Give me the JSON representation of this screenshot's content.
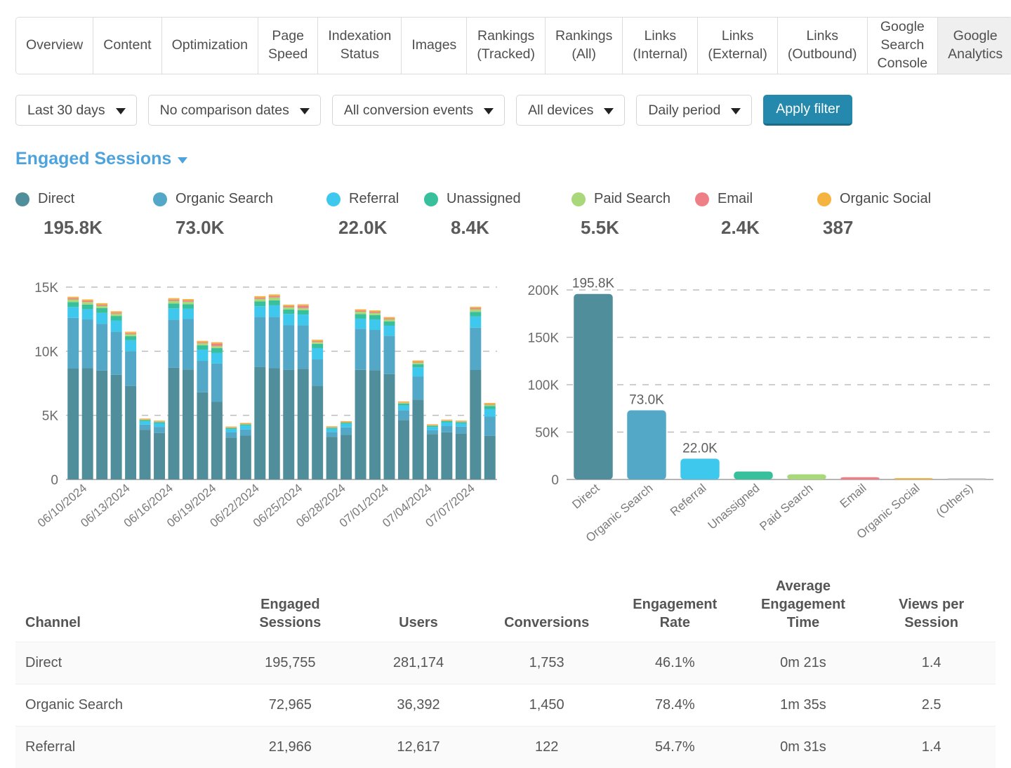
{
  "tabs": [
    {
      "label": "Overview",
      "active": false
    },
    {
      "label": "Content",
      "active": false
    },
    {
      "label": "Optimization",
      "active": false
    },
    {
      "label": "Page\nSpeed",
      "active": false
    },
    {
      "label": "Indexation\nStatus",
      "active": false
    },
    {
      "label": "Images",
      "active": false
    },
    {
      "label": "Rankings\n(Tracked)",
      "active": false
    },
    {
      "label": "Rankings\n(All)",
      "active": false
    },
    {
      "label": "Links\n(Internal)",
      "active": false
    },
    {
      "label": "Links\n(External)",
      "active": false
    },
    {
      "label": "Links\n(Outbound)",
      "active": false
    },
    {
      "label": "Google Search\nConsole",
      "active": false
    },
    {
      "label": "Google\nAnalytics",
      "active": true
    }
  ],
  "filters": {
    "date_range": "Last 30 days",
    "comparison": "No comparison dates",
    "conversion_events": "All conversion events",
    "devices": "All devices",
    "period": "Daily period",
    "apply_label": "Apply filter"
  },
  "metric": {
    "title": "Engaged Sessions"
  },
  "legend": [
    {
      "label": "Direct",
      "value": "195.8K",
      "color": "#4f8e9a"
    },
    {
      "label": "Organic Search",
      "value": "73.0K",
      "color": "#54a8c7"
    },
    {
      "label": "Referral",
      "value": "22.0K",
      "color": "#3ec8ee"
    },
    {
      "label": "Unassigned",
      "value": "8.4K",
      "color": "#38bf9c"
    },
    {
      "label": "Paid Search",
      "value": "5.5K",
      "color": "#a8d87a"
    },
    {
      "label": "Email",
      "value": "2.4K",
      "color": "#ef7f86"
    },
    {
      "label": "Organic Social",
      "value": "387",
      "color": "#f5b33f"
    }
  ],
  "chart_data": [
    {
      "type": "bar",
      "id": "daily-stacked",
      "stacked": true,
      "title": "",
      "xlabel": "",
      "ylabel": "",
      "ylim": [
        0,
        15000
      ],
      "yticks": [
        0,
        5000,
        10000,
        15000
      ],
      "ytick_labels": [
        "0",
        "5K",
        "10K",
        "15K"
      ],
      "grid": true,
      "legend_position": "top",
      "x": [
        "06/09/2024",
        "06/10/2024",
        "06/11/2024",
        "06/12/2024",
        "06/13/2024",
        "06/14/2024",
        "06/15/2024",
        "06/16/2024",
        "06/17/2024",
        "06/18/2024",
        "06/19/2024",
        "06/20/2024",
        "06/21/2024",
        "06/22/2024",
        "06/23/2024",
        "06/24/2024",
        "06/25/2024",
        "06/26/2024",
        "06/27/2024",
        "06/28/2024",
        "06/29/2024",
        "06/30/2024",
        "07/01/2024",
        "07/02/2024",
        "07/03/2024",
        "07/04/2024",
        "07/05/2024",
        "07/06/2024",
        "07/07/2024",
        "07/08/2024"
      ],
      "xtick_labels": [
        "06/10/2024",
        "06/13/2024",
        "06/16/2024",
        "06/19/2024",
        "06/22/2024",
        "06/25/2024",
        "06/28/2024",
        "07/01/2024",
        "07/04/2024",
        "07/07/2024"
      ],
      "series": [
        {
          "name": "Direct",
          "color": "#4f8e9a",
          "values": [
            8650,
            8680,
            8500,
            8170,
            7300,
            3880,
            3620,
            8720,
            8580,
            6800,
            6050,
            3270,
            3420,
            8780,
            8680,
            8560,
            8640,
            7280,
            3330,
            3480,
            8550,
            8530,
            8220,
            4640,
            6220,
            3540,
            3680,
            3580,
            8540,
            3400
          ]
        },
        {
          "name": "Organic Search",
          "color": "#54a8c7",
          "values": [
            3950,
            3800,
            3630,
            3350,
            2700,
            400,
            480,
            3750,
            3930,
            2450,
            3000,
            420,
            480,
            3900,
            4000,
            3480,
            3380,
            2080,
            380,
            580,
            3200,
            3130,
            2990,
            760,
            1800,
            300,
            480,
            540,
            3300,
            1500
          ]
        },
        {
          "name": "Referral",
          "color": "#3ec8ee",
          "values": [
            850,
            800,
            860,
            880,
            850,
            260,
            280,
            870,
            800,
            880,
            830,
            240,
            300,
            830,
            900,
            870,
            840,
            880,
            240,
            280,
            790,
            820,
            780,
            380,
            720,
            250,
            300,
            260,
            870,
            600
          ]
        },
        {
          "name": "Unassigned",
          "color": "#38bf9c",
          "values": [
            380,
            360,
            370,
            350,
            330,
            90,
            90,
            380,
            360,
            340,
            360,
            80,
            90,
            370,
            390,
            350,
            340,
            330,
            80,
            90,
            350,
            340,
            330,
            140,
            250,
            90,
            90,
            90,
            360,
            230
          ]
        },
        {
          "name": "Paid Search",
          "color": "#a8d87a",
          "values": [
            210,
            200,
            190,
            180,
            150,
            40,
            40,
            210,
            200,
            160,
            170,
            40,
            40,
            210,
            230,
            180,
            170,
            150,
            40,
            40,
            190,
            180,
            170,
            60,
            120,
            40,
            40,
            40,
            200,
            100
          ]
        },
        {
          "name": "Email",
          "color": "#ef7f86",
          "values": [
            100,
            95,
            95,
            90,
            70,
            20,
            20,
            100,
            95,
            80,
            190,
            20,
            20,
            100,
            110,
            90,
            190,
            70,
            20,
            20,
            90,
            85,
            80,
            30,
            60,
            20,
            20,
            20,
            95,
            50
          ]
        },
        {
          "name": "Organic Social",
          "color": "#f5b33f",
          "values": [
            110,
            105,
            105,
            100,
            120,
            60,
            60,
            110,
            105,
            100,
            105,
            60,
            60,
            110,
            120,
            100,
            100,
            110,
            60,
            60,
            100,
            100,
            95,
            80,
            110,
            60,
            60,
            60,
            105,
            90
          ]
        }
      ]
    },
    {
      "type": "bar",
      "id": "channel-totals",
      "stacked": false,
      "title": "",
      "xlabel": "",
      "ylabel": "",
      "ylim": [
        0,
        200000
      ],
      "yticks": [
        0,
        50000,
        100000,
        150000,
        200000
      ],
      "ytick_labels": [
        "0",
        "50K",
        "100K",
        "150K",
        "200K"
      ],
      "grid": true,
      "categories": [
        "Direct",
        "Organic Search",
        "Referral",
        "Unassigned",
        "Paid Search",
        "Email",
        "Organic Social",
        "(Others)"
      ],
      "values": [
        195755,
        72965,
        21966,
        8400,
        5500,
        2400,
        387,
        0
      ],
      "value_labels": [
        "195.8K",
        "73.0K",
        "22.0K",
        "",
        "",
        "",
        "",
        ""
      ],
      "colors": [
        "#4f8e9a",
        "#54a8c7",
        "#3ec8ee",
        "#38bf9c",
        "#a8d87a",
        "#ef7f86",
        "#f5b33f",
        "#cccccc"
      ]
    }
  ],
  "table": {
    "headers": [
      "Channel",
      "Engaged\nSessions",
      "Users",
      "Conversions",
      "Engagement\nRate",
      "Average\nEngagement Time",
      "Views per\nSession"
    ],
    "rows": [
      [
        "Direct",
        "195,755",
        "281,174",
        "1,753",
        "46.1%",
        "0m 21s",
        "1.4"
      ],
      [
        "Organic Search",
        "72,965",
        "36,392",
        "1,450",
        "78.4%",
        "1m 35s",
        "2.5"
      ],
      [
        "Referral",
        "21,966",
        "12,617",
        "122",
        "54.7%",
        "0m 31s",
        "1.4"
      ]
    ]
  }
}
